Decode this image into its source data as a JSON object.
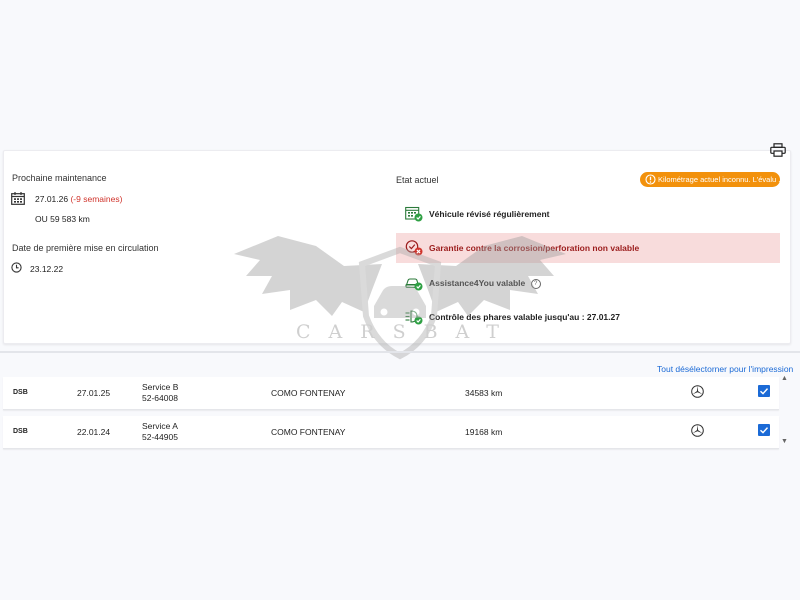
{
  "maintenance": {
    "label": "Prochaine maintenance",
    "date": "27.01.26",
    "overdue": "(-9 semaines)",
    "km": "OU 59 583 km"
  },
  "registration": {
    "label": "Date de première mise en circulation",
    "date": "23.12.22"
  },
  "status": {
    "label": "Etat actuel",
    "warning": "Kilométrage actuel inconnu. L'évalu ...",
    "items": [
      {
        "text": "Véhicule révisé régulièrement",
        "icon": "calendar-check-icon",
        "state": "ok"
      },
      {
        "text": "Garantie contre la corrosion/perforation non valable",
        "icon": "warranty-x-icon",
        "state": "error"
      },
      {
        "text": "Assistance4You valable",
        "icon": "assistance-car-icon",
        "state": "ok",
        "info": "?"
      },
      {
        "text": "Contrôle des phares valable jusqu'au : 27.01.27",
        "icon": "headlight-check-icon",
        "state": "ok"
      }
    ]
  },
  "history": {
    "deselect_label": "Tout désélectorner pour l'impression",
    "rows": [
      {
        "code": "DSB",
        "date": "27.01.25",
        "service": "Service B",
        "order": "52-64008",
        "dealer": "COMO FONTENAY",
        "km": "34583 km",
        "checked": true
      },
      {
        "code": "DSB",
        "date": "22.01.24",
        "service": "Service A",
        "order": "52-44905",
        "dealer": "COMO FONTENAY",
        "km": "19168 km",
        "checked": true
      }
    ]
  },
  "watermark": {
    "text": "CARSBAT"
  },
  "colors": {
    "accent": "#1b6ad6",
    "warning": "#f2910c",
    "error_bg": "#f8dcdc",
    "error_text": "#9b1c1c",
    "ok": "#2ea043"
  }
}
